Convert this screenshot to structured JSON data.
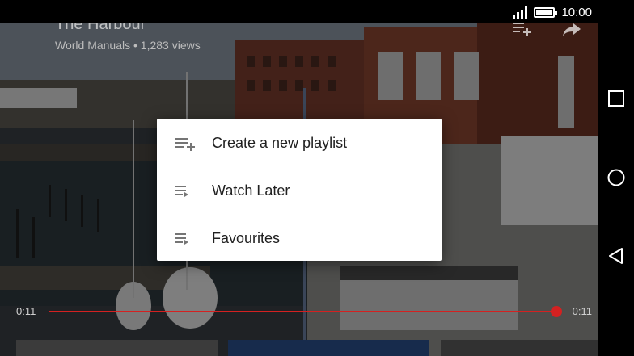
{
  "status_bar": {
    "time": "10:00",
    "signal_icon": "signal-icon",
    "battery_icon": "battery-icon",
    "battery_level": 1.0
  },
  "video": {
    "title": "The Harbour",
    "meta": "World Manuals • 1,283 views",
    "current_time": "0:11",
    "total_time": "0:11",
    "progress": 1.0,
    "accent_color": "#d42121",
    "top_icons": [
      "add-to-playlist-icon",
      "share-icon"
    ]
  },
  "menu": {
    "items": [
      {
        "label": "Create a new playlist",
        "icon": "playlist-add-icon"
      },
      {
        "label": "Watch Later",
        "icon": "playlist-play-icon"
      },
      {
        "label": "Favourites",
        "icon": "playlist-play-icon"
      }
    ]
  },
  "nav_bar": {
    "icons": [
      "recents-icon",
      "home-icon",
      "back-icon"
    ]
  }
}
